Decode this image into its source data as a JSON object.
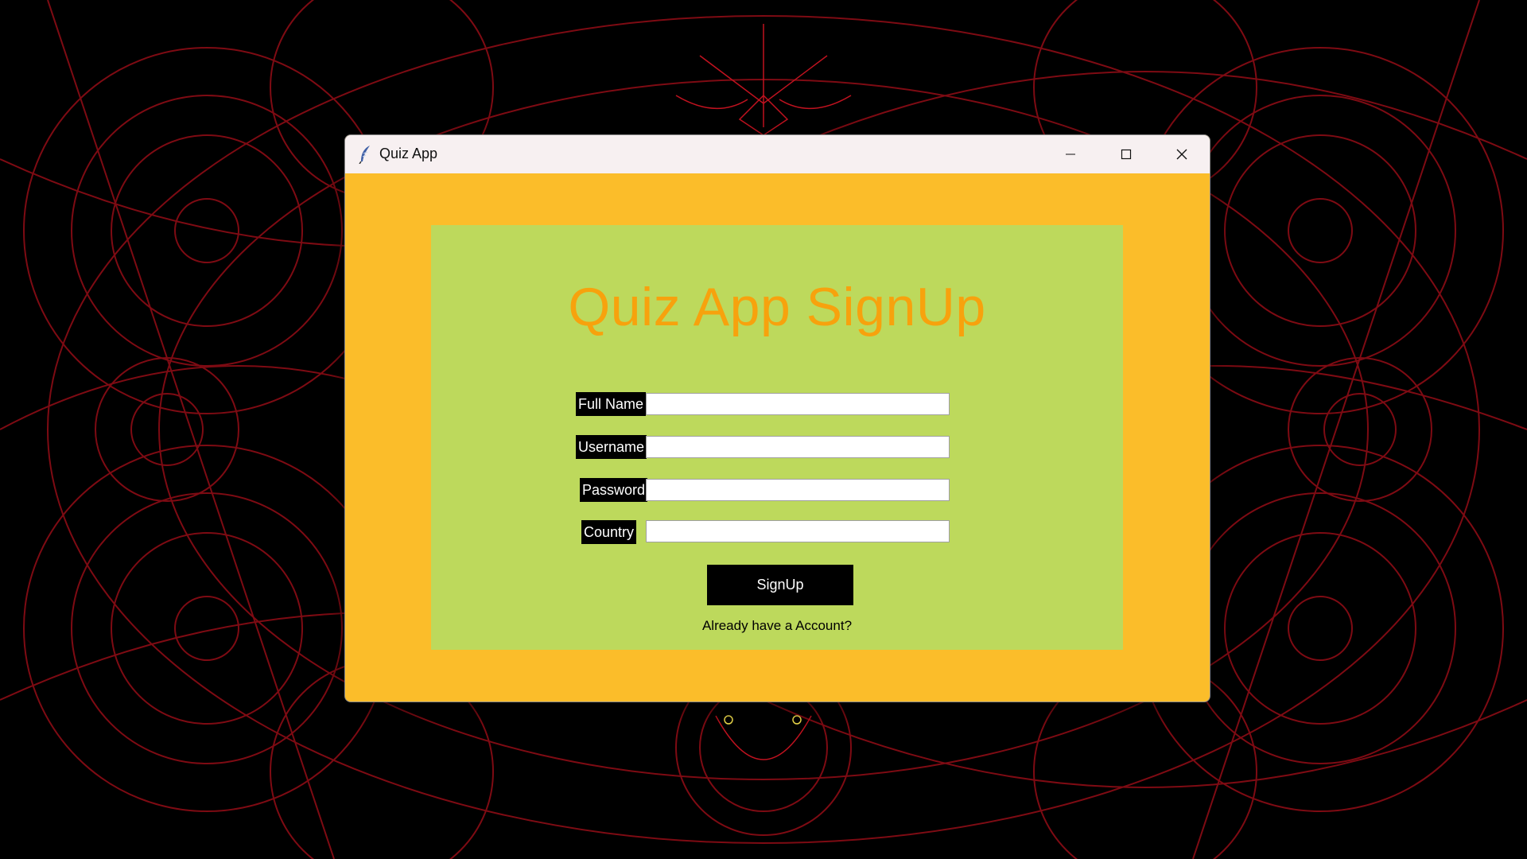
{
  "window": {
    "title": "Quiz App"
  },
  "form": {
    "heading": "Quiz App SignUp",
    "fields": [
      {
        "label": "Full Name",
        "value": ""
      },
      {
        "label": "Username",
        "value": ""
      },
      {
        "label": "Password",
        "value": ""
      },
      {
        "label": "Country",
        "value": ""
      }
    ],
    "submit_label": "SignUp",
    "login_link": "Already have a Account?"
  },
  "icons": {
    "app": "feather-icon",
    "minimize": "minimize-icon",
    "maximize": "maximize-icon",
    "close": "close-icon"
  },
  "colors": {
    "window_bg": "#fbbd2a",
    "panel_bg": "#bdd95c",
    "heading": "#f7a20d",
    "label_bg": "#000000",
    "wallpaper_line": "#b0101c"
  }
}
